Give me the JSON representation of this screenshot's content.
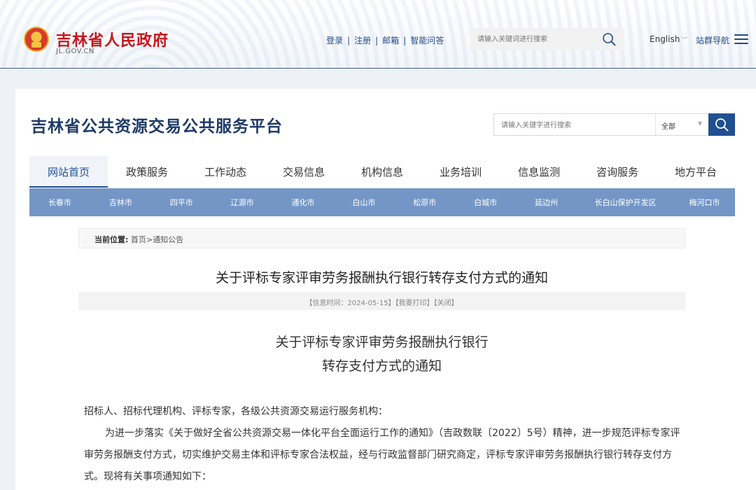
{
  "gov_header": {
    "title": "吉林省人民政府",
    "domain": "JL.GOV.CN",
    "links": [
      "登录",
      "注册",
      "邮箱",
      "智能问答"
    ],
    "search_placeholder": "请输入关键词进行搜索",
    "language": "English",
    "site_nav": "站群导航"
  },
  "platform": {
    "title": "吉林省公共资源交易公共服务平台",
    "search_placeholder": "请输入关键字进行搜索",
    "search_scope": "全部"
  },
  "main_nav": [
    "网站首页",
    "政策服务",
    "工作动态",
    "交易信息",
    "机构信息",
    "业务培训",
    "信息监测",
    "咨询服务",
    "地方平台"
  ],
  "active_tab": "网站首页",
  "cities": [
    "长春市",
    "吉林市",
    "四平市",
    "辽源市",
    "通化市",
    "白山市",
    "松原市",
    "白城市",
    "延边州",
    "长白山保护开发区",
    "梅河口市"
  ],
  "breadcrumb": {
    "label": "当前位置:",
    "home": "首页",
    "separator": ">",
    "current": "通知公告"
  },
  "article": {
    "title": "关于评标专家评审劳务报酬执行银行转存支付方式的通知",
    "meta_time": "【信息时间：2024-05-15】",
    "meta_print": "【我要打印】",
    "meta_close": "【关闭】",
    "doc_title_line1": "关于评标专家评审劳务报酬执行银行",
    "doc_title_line2": "转存支付方式的通知",
    "salutation": "招标人、招标代理机构、评标专家，各级公共资源交易运行服务机构：",
    "paragraph1": "为进一步落实《关于做好全省公共资源交易一体化平台全面运行工作的通知》（吉政数联〔2022〕5号）精神，进一步规范评标专家评审劳务报酬支付方式，切实维护交易主体和评标专家合法权益，经与行政监督部门研究商定，评标专家评审劳务报酬执行银行转存支付方式。现将有关事项通知如下："
  }
}
